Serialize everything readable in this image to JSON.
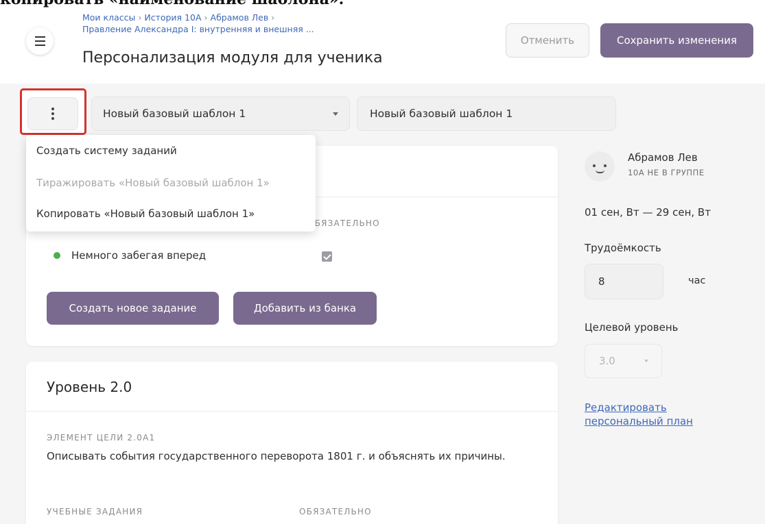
{
  "caption": "копировать «наименование шаблона».",
  "header": {
    "breadcrumb": [
      "Мои классы",
      "История 10А",
      "Абрамов Лев",
      "Правление Александра I: внутренняя и внешняя ..."
    ],
    "title": "Персонализация модуля для ученика",
    "cancel_label": "Отменить",
    "save_label": "Сохранить изменения"
  },
  "toolbar": {
    "template_select_value": "Новый базовый шаблон 1",
    "template_name_value": "Новый базовый шаблон 1"
  },
  "dropdown_menu": {
    "items": [
      {
        "label": "Создать систему заданий",
        "disabled": false
      },
      {
        "label": "Тиражировать «Новый базовый шаблон 1»",
        "disabled": true
      },
      {
        "label": "Копировать «Новый базовый шаблон 1»",
        "disabled": false
      }
    ]
  },
  "card1": {
    "required_header": "ОБЯЗАТЕЛЬНО",
    "task": {
      "label": "Немного забегая вперед",
      "status": "done",
      "required": true
    },
    "create_task_label": "Создать новое задание",
    "add_from_bank_label": "Добавить из банка"
  },
  "card2": {
    "level_title": "Уровень 2.0",
    "goal_label": "ЭЛЕМЕНТ ЦЕЛИ 2.0А1",
    "goal_text": "Описывать события государственного переворота 1801 г. и объяснять их причины.",
    "tasks_header": "УЧЕБНЫЕ ЗАДАНИЯ",
    "required_header": "ОБЯЗАТЕЛЬНО"
  },
  "sidebar": {
    "student_name": "Абрамов Лев",
    "student_group": "10А НЕ В ГРУППЕ",
    "date_range": "01 сен, Вт — 29 сен, Вт",
    "workload_label": "Трудоёмкость",
    "hours_value": "8",
    "hours_unit": "час",
    "target_level_label": "Целевой уровень",
    "target_level_value": "3.0",
    "edit_plan_link": "Редактировать персональный план"
  },
  "colors": {
    "accent": "#7a6a8f",
    "link": "#3d68b8",
    "highlight": "#d4332e",
    "success": "#4caf50"
  }
}
